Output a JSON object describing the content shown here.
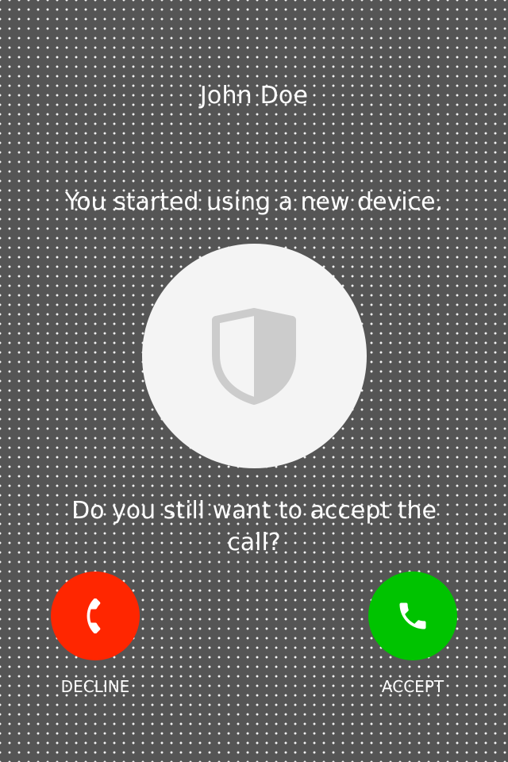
{
  "caller": {
    "name": "John Doe"
  },
  "notice": {
    "text": "You started using a new device."
  },
  "security_icon": {
    "name": "shield-icon",
    "color": "#cccccc",
    "background": "#f4f4f4"
  },
  "question": {
    "text": "Do you still want to accept the call?"
  },
  "actions": {
    "decline": {
      "label": "DECLINE",
      "icon": "phone-hangup-icon",
      "color": "#ff2600"
    },
    "accept": {
      "label": "ACCEPT",
      "icon": "phone-icon",
      "color": "#00c300"
    }
  },
  "colors": {
    "background": "#555555",
    "text": "#ffffff"
  }
}
